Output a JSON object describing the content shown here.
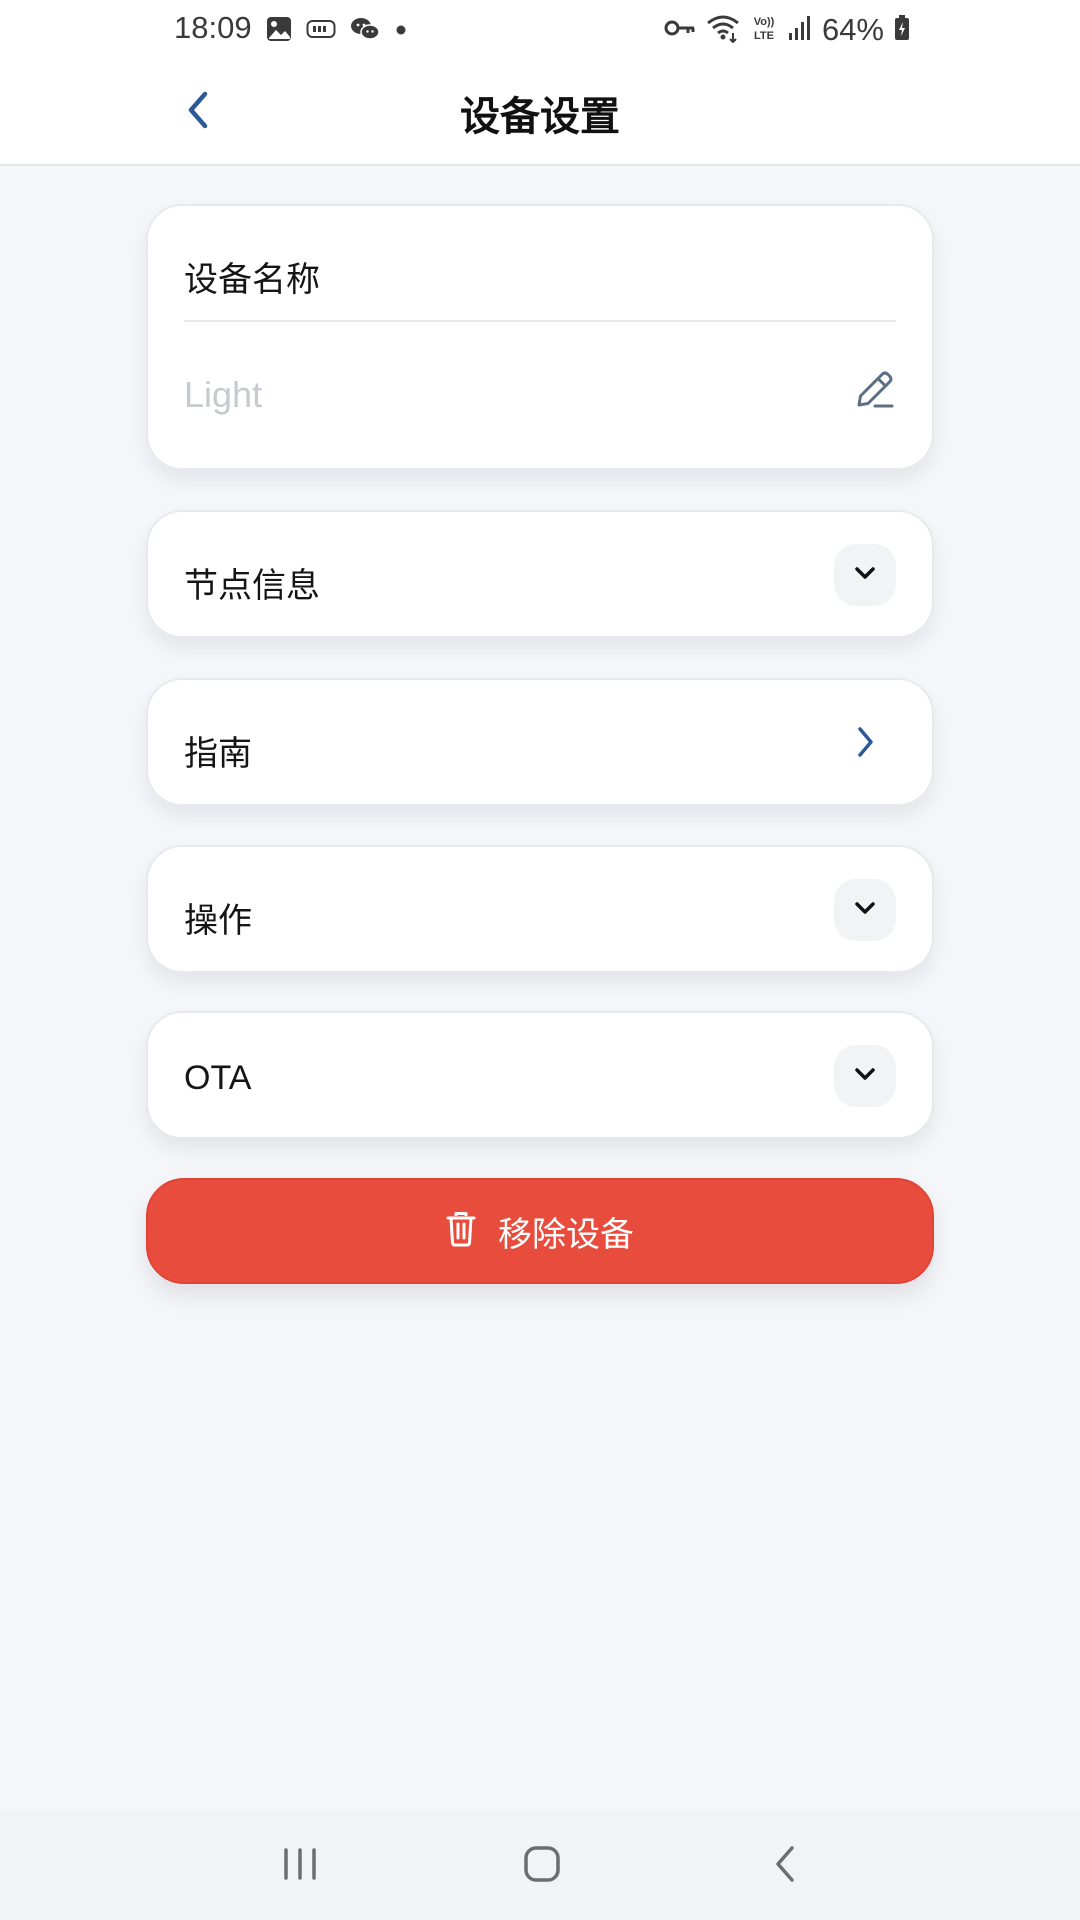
{
  "status_bar": {
    "time": "18:09",
    "battery_percent": "64%",
    "left_icons": [
      "gallery-icon",
      "tag-icon",
      "wechat-icon",
      "dot-icon"
    ],
    "right_icons": [
      "key-icon",
      "wifi-icon",
      "volte-icon",
      "signal-icon",
      "battery-icon"
    ]
  },
  "header": {
    "title": "设备设置",
    "back_icon": "chevron-left-icon"
  },
  "device_name": {
    "label": "设备名称",
    "placeholder": "Light",
    "value": ""
  },
  "sections": {
    "node_info": {
      "label": "节点信息",
      "icon": "chevron-down-icon"
    },
    "guide": {
      "label": "指南",
      "icon": "chevron-right-icon"
    },
    "operations": {
      "label": "操作",
      "icon": "chevron-down-icon"
    },
    "ota": {
      "label": "OTA",
      "icon": "chevron-down-icon"
    }
  },
  "remove_button": {
    "label": "移除设备",
    "icon": "trash-icon"
  },
  "colors": {
    "accent_blue": "#2d5a96",
    "danger_red": "#e84c3d",
    "background": "#f5f6f9"
  },
  "nav_bar": {
    "icons": [
      "recent-apps-icon",
      "home-icon",
      "back-icon"
    ]
  }
}
